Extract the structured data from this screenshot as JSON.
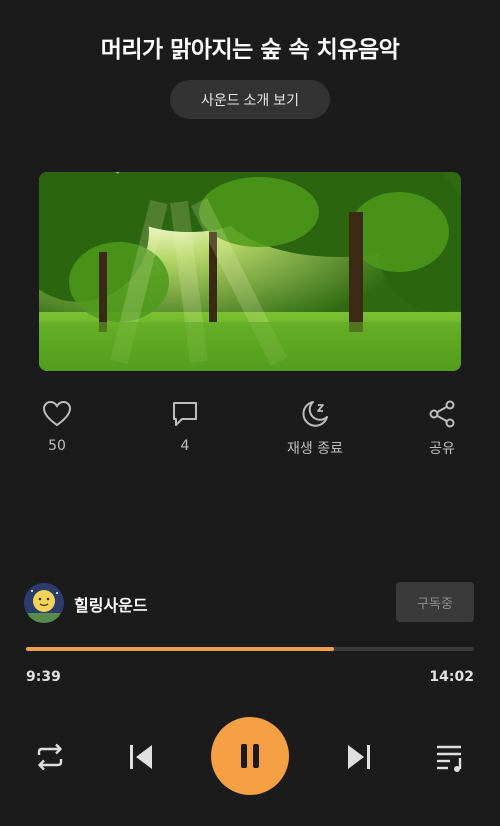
{
  "track": {
    "title": "머리가 맑아지는 숲 속 치유음악",
    "intro_button": "사운드 소개 보기"
  },
  "artwork": {
    "description_icon": "forest-artwork"
  },
  "actions": {
    "like_count": "50",
    "comment_count": "4",
    "sleep_timer_label": "재생 종료",
    "share_label": "공유"
  },
  "channel": {
    "name": "힐링사운드",
    "subscribe_label": "구독중"
  },
  "player": {
    "current_time": "9:39",
    "total_time": "14:02",
    "progress_percent": 68.7,
    "state": "playing"
  },
  "colors": {
    "accent": "#f5a044",
    "background": "#1b1b1b",
    "button_bg": "#333333"
  },
  "icons": [
    "heart-icon",
    "comment-icon",
    "moon-sleep-icon",
    "share-icon",
    "repeat-icon",
    "skip-previous-icon",
    "pause-icon",
    "skip-next-icon",
    "playlist-icon"
  ]
}
